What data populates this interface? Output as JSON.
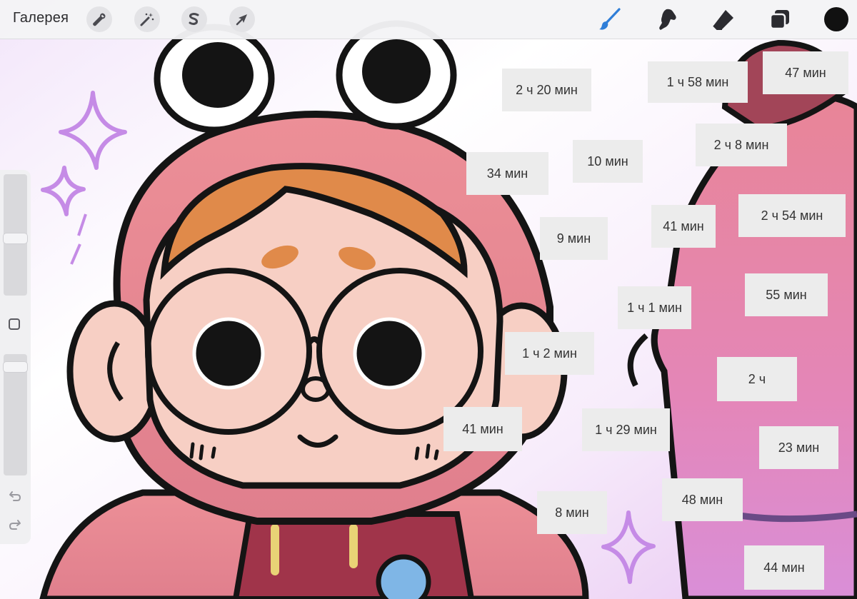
{
  "toolbar": {
    "gallery_label": "Галерея",
    "left_tools": [
      {
        "name": "Actions",
        "icon": "wrench-icon"
      },
      {
        "name": "Adjustments",
        "icon": "magic-wand-icon"
      },
      {
        "name": "Selection",
        "icon": "selection-s-icon"
      },
      {
        "name": "Transform",
        "icon": "arrow-cursor-icon"
      }
    ],
    "right_tools": [
      {
        "name": "Brush",
        "icon": "brush-icon",
        "active": true
      },
      {
        "name": "Smudge",
        "icon": "smudge-icon",
        "active": false
      },
      {
        "name": "Eraser",
        "icon": "eraser-icon",
        "active": false
      },
      {
        "name": "Layers",
        "icon": "layers-icon",
        "active": false
      }
    ],
    "current_color": "#111111",
    "active_tool_color": "#2f7ed8"
  },
  "sidebar": {
    "brush_size_level": 0.53,
    "opacity_level": 0.07,
    "modify_icon": "square-icon",
    "undo_icon": "undo-icon",
    "redo_icon": "redo-icon"
  },
  "time_labels": [
    {
      "text": "2 ч 20 мин"
    },
    {
      "text": "1 ч 58 мин"
    },
    {
      "text": "47 мин"
    },
    {
      "text": "34 мин"
    },
    {
      "text": "10 мин"
    },
    {
      "text": "2 ч 8 мин"
    },
    {
      "text": "9 мин"
    },
    {
      "text": "41 мин"
    },
    {
      "text": "2 ч 54 мин"
    },
    {
      "text": "1 ч 1 мин"
    },
    {
      "text": "55 мин"
    },
    {
      "text": "1 ч 2 мин"
    },
    {
      "text": "2 ч"
    },
    {
      "text": "41 мин"
    },
    {
      "text": "1 ч 29 мин"
    },
    {
      "text": "23 мин"
    },
    {
      "text": "48 мин"
    },
    {
      "text": "8 мин"
    },
    {
      "text": "44 мин"
    }
  ],
  "colors": {
    "hood_pink": "#e8848e",
    "skin": "#f7cfc4",
    "hair": "#e08a4a",
    "ear_dark": "#a24558",
    "sparkle": "#c58be6",
    "outline": "#141414"
  }
}
